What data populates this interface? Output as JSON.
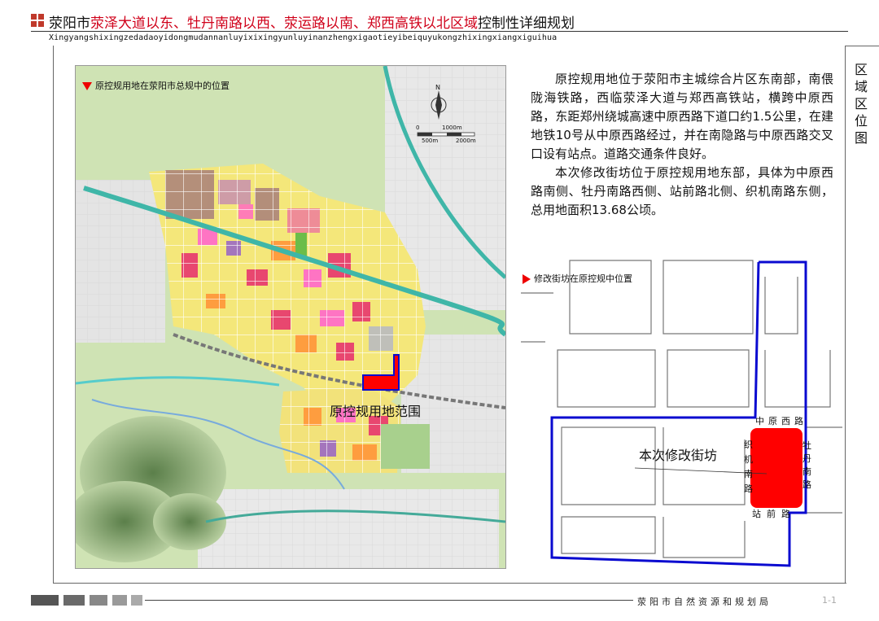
{
  "header": {
    "title_prefix": "荥阳市",
    "title_highlight": "荥泽大道以东、牡丹南路以西、荥运路以南、郑西高铁以北区域",
    "title_suffix": "控制性详细规划",
    "pinyin": "Xingyangshixingzedadaoyidongmudannanluyixixingyunluyinanzhengxigaotieyibeiquyukongzhixingxiangxiguihua"
  },
  "sidebar": {
    "title": "区域区位图"
  },
  "description": {
    "paragraph1": "原控规用地位于荥阳市主城综合片区东南部，南偎陇海铁路，西临荥泽大道与郑西高铁站，横跨中原西路，东距郑州绕城高速中原西路下道口约1.5公里，在建地铁10号从中原西路经过，并在南隐路与中原西路交叉口设有站点。道路交通条件良好。",
    "paragraph2": "本次修改街坊位于原控规用地东部，具体为中原西路南侧、牡丹南路西侧、站前路北侧、织机南路东侧，总用地面积13.68公顷。"
  },
  "left_map": {
    "caption": "原控规用地在荥阳市总规中的位置",
    "area_label": "原控规用地范围",
    "north_label": "N",
    "scale_labels": [
      "0",
      "1000m",
      "500m",
      "2000m"
    ]
  },
  "right_map": {
    "caption": "修改街坊在原控规中位置",
    "block_label": "本次修改街坊",
    "road_north": "中原西路",
    "road_east": "牡丹南路",
    "road_west": "织机南路",
    "road_south": "站前路"
  },
  "footer": {
    "org": "荥阳市自然资源和规划局",
    "page": "1-1"
  },
  "colors": {
    "title_red": "#d0021b",
    "boundary_blue": "#0a0ad0",
    "site_red": "#ff0000",
    "map_green": "#cfe3b4",
    "rail_teal": "#3fb6a8"
  }
}
